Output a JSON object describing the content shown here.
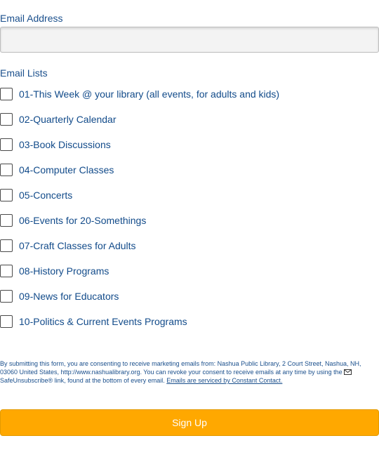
{
  "form": {
    "email_label": "Email Address",
    "email_value": "",
    "email_placeholder": "",
    "lists_label": "Email Lists",
    "lists": [
      {
        "label": "01-This Week @ your library (all events, for adults and kids)",
        "checked": false
      },
      {
        "label": "02-Quarterly Calendar",
        "checked": false
      },
      {
        "label": "03-Book Discussions",
        "checked": false
      },
      {
        "label": "04-Computer Classes",
        "checked": false
      },
      {
        "label": "05-Concerts",
        "checked": false
      },
      {
        "label": "06-Events for 20-Somethings",
        "checked": false
      },
      {
        "label": "07-Craft Classes for Adults",
        "checked": false
      },
      {
        "label": "08-History Programs",
        "checked": false
      },
      {
        "label": "09-News for Educators",
        "checked": false
      },
      {
        "label": "10-Politics & Current Events Programs",
        "checked": false
      }
    ],
    "consent_text_1": "By submitting this form, you are consenting to receive marketing emails from: Nashua Public Library, 2 Court Street, Nashua, NH, 03060 United States, http://www.nashualibrary.org. You can revoke your consent to receive emails at any time by using the",
    "consent_text_2": "SafeUnsubscribe® link, found at the bottom of every email.",
    "consent_link": "Emails are serviced by Constant Contact.",
    "consent_icon": "envelope-icon",
    "submit_label": "Sign Up"
  },
  "colors": {
    "text": "#124b8a",
    "button_bg": "#ffa800",
    "button_text": "#ffffff",
    "input_bg": "#f3f3f3"
  }
}
